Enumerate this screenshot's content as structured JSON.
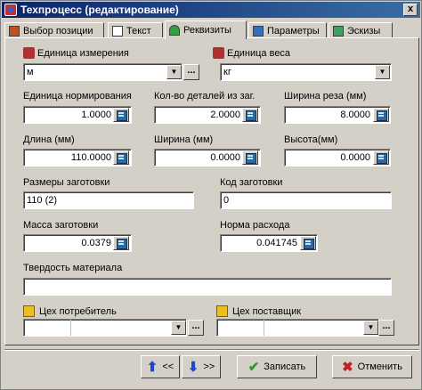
{
  "window": {
    "title": "Техпроцесс (редактирование)",
    "close_label": "x"
  },
  "tabs": [
    {
      "label": "Выбор позиции"
    },
    {
      "label": "Текст"
    },
    {
      "label": "Реквизиты",
      "active": true
    },
    {
      "label": "Параметры"
    },
    {
      "label": "Эскизы"
    }
  ],
  "form": {
    "unit_measure": {
      "label": "Единица измерения",
      "value": "м"
    },
    "unit_weight": {
      "label": "Единица веса",
      "value": "кг"
    },
    "norm_unit": {
      "label": "Единица нормирования",
      "value": "1.0000"
    },
    "parts_count": {
      "label": "Кол-во деталей из заг.",
      "value": "2.0000"
    },
    "cut_width": {
      "label": "Ширина реза (мм)",
      "value": "8.0000"
    },
    "length": {
      "label": "Длина (мм)",
      "value": "110.0000"
    },
    "width": {
      "label": "Ширина (мм)",
      "value": "0.0000"
    },
    "height": {
      "label": "Высота(мм)",
      "value": "0.0000"
    },
    "blank_size": {
      "label": "Размеры заготовки",
      "value": "110 (2)"
    },
    "blank_code": {
      "label": "Код заготовки",
      "value": "0"
    },
    "blank_mass": {
      "label": "Масса заготовки",
      "value": "0.0379"
    },
    "consumption": {
      "label": "Норма расхода",
      "value": "0.041745"
    },
    "hardness": {
      "label": "Твердость материала",
      "value": ""
    },
    "shop_consumer": {
      "label": "Цех потребитель",
      "value": ""
    },
    "shop_supplier": {
      "label": "Цех поставщик",
      "value": ""
    }
  },
  "buttons": {
    "prev": "<<",
    "next": ">>",
    "save": "Записать",
    "cancel": "Отменить"
  },
  "glyphs": {
    "dots": "...",
    "dropdown": "▼",
    "up": "⬆",
    "down": "⬇",
    "check": "✔",
    "cross": "✖"
  },
  "colors": {
    "title_bar": "#0a246a",
    "dialog_bg": "#d4d0c8",
    "save_green": "#2a9a2a",
    "cancel_red": "#c02020",
    "nav_blue": "#1a4ac8"
  }
}
